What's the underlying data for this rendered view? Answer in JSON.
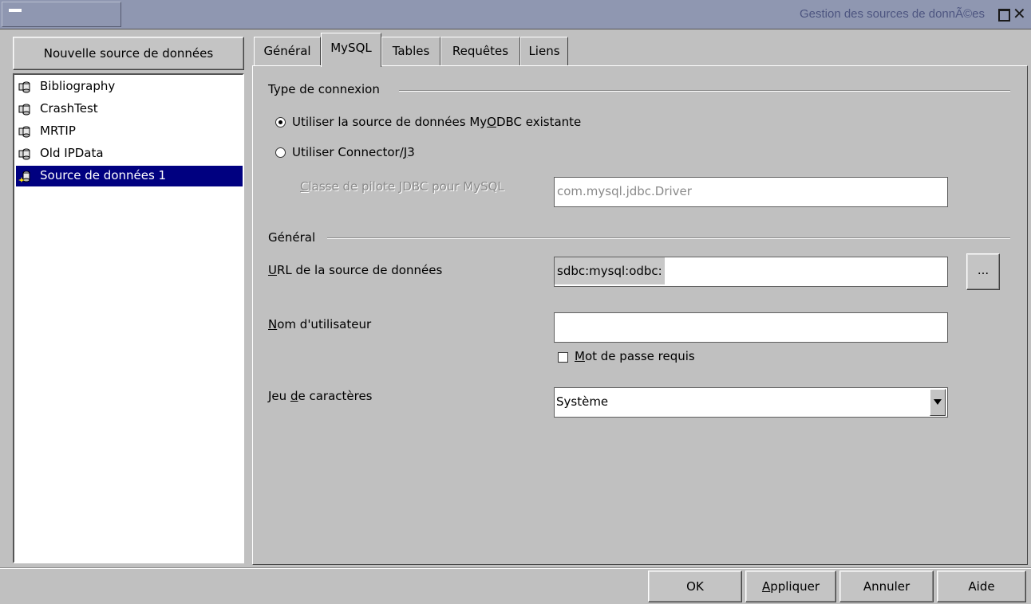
{
  "window": {
    "title": "Gestion des sources de donnÃ©es"
  },
  "sidebar": {
    "new_source_label": "Nouvelle source de données",
    "items": [
      {
        "label": "Bibliography",
        "icon": "database-icon",
        "selected": false
      },
      {
        "label": "CrashTest",
        "icon": "database-icon",
        "selected": false
      },
      {
        "label": "MRTIP",
        "icon": "database-icon",
        "selected": false
      },
      {
        "label": "Old IPData",
        "icon": "database-icon",
        "selected": false
      },
      {
        "label": "Source de données 1",
        "icon": "new-database-icon",
        "selected": true
      }
    ]
  },
  "tabs": [
    {
      "label": "Général",
      "active": false
    },
    {
      "label": "MySQL",
      "active": true
    },
    {
      "label": "Tables",
      "active": false
    },
    {
      "label": "Requêtes",
      "active": false
    },
    {
      "label": "Liens",
      "active": false
    }
  ],
  "connection": {
    "group_title": "Type de connexion",
    "radio_myodbc": {
      "pre": "Utiliser la source de données My",
      "mnemonic": "O",
      "post": "DBC existante",
      "checked": true
    },
    "radio_connector": {
      "pre": "Utiliser Connector/",
      "mnemonic": "J",
      "post": "3",
      "checked": false
    },
    "jdbc_label": {
      "mnemonic": "C",
      "post": "lasse de pilote JDBC pour MySQL"
    },
    "jdbc_value": "com.mysql.jdbc.Driver"
  },
  "general": {
    "group_title": "Général",
    "url_label": {
      "mnemonic": "U",
      "post": "RL de la source de données"
    },
    "url_prefix": "sdbc:mysql:odbc:",
    "url_value": "",
    "browse_label": "...",
    "user_label": {
      "mnemonic": "N",
      "post": "om d'utilisateur"
    },
    "user_value": "",
    "password_label": {
      "mnemonic": "M",
      "post": "ot de passe requis"
    },
    "password_required": false,
    "charset_label": {
      "pre": "Jeu ",
      "mnemonic": "d",
      "post": "e caractères"
    },
    "charset_value": "Système"
  },
  "footer": {
    "ok": "OK",
    "apply": {
      "mnemonic": "A",
      "post": "ppliquer"
    },
    "cancel": "Annuler",
    "help": "Aide"
  },
  "colors": {
    "titlebar": "#8f97b1",
    "selection": "#000080",
    "window_bg": "#c0c0c0"
  }
}
